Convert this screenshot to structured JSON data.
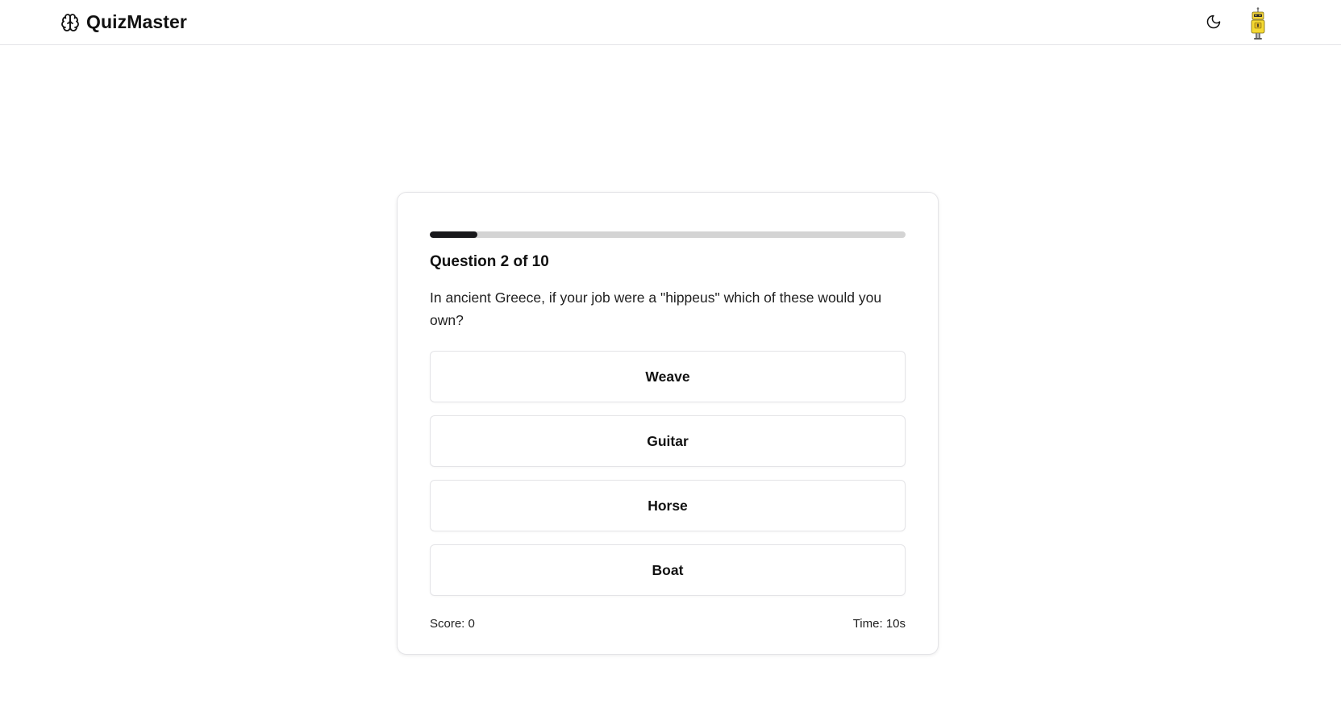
{
  "header": {
    "brand_name": "QuizMaster",
    "brand_icon": "brain-icon",
    "theme_icon": "moon-icon",
    "avatar_icon": "robot-avatar-icon"
  },
  "quiz": {
    "question_header": "Question 2 of 10",
    "question_text": "In ancient Greece, if your job were a \"hippeus\" which of these would you own?",
    "progress_fraction": 0.1,
    "options": [
      "Weave",
      "Guitar",
      "Horse",
      "Boat"
    ],
    "score_text": "Score: 0",
    "time_text": "Time: 10s"
  },
  "colors": {
    "accent": "#18181b",
    "progress_track": "#d4d4d4",
    "border": "#e4e4e7",
    "background": "#ffffff"
  }
}
